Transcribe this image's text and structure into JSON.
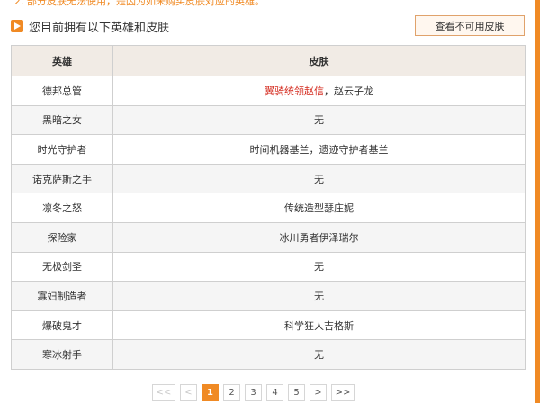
{
  "top_note": "2.   部分皮肤无法使用，是因为如未购买皮肤对应的英雄。",
  "header": {
    "title": "您目前拥有以下英雄和皮肤",
    "unavailable_button": "查看不可用皮肤"
  },
  "table": {
    "columns": [
      "英雄",
      "皮肤"
    ],
    "rows": [
      {
        "hero": "德邦总管",
        "skin_highlight": "翼骑统领赵信",
        "skin_rest": "，赵云子龙"
      },
      {
        "hero": "黑暗之女",
        "skin_highlight": "",
        "skin_rest": "无"
      },
      {
        "hero": "时光守护者",
        "skin_highlight": "",
        "skin_rest": "时间机器基兰，遗迹守护者基兰"
      },
      {
        "hero": "诺克萨斯之手",
        "skin_highlight": "",
        "skin_rest": "无"
      },
      {
        "hero": "凛冬之怒",
        "skin_highlight": "",
        "skin_rest": "传统造型瑟庄妮"
      },
      {
        "hero": "探险家",
        "skin_highlight": "",
        "skin_rest": "冰川勇者伊泽瑞尔"
      },
      {
        "hero": "无极剑圣",
        "skin_highlight": "",
        "skin_rest": "无"
      },
      {
        "hero": "寡妇制造者",
        "skin_highlight": "",
        "skin_rest": "无"
      },
      {
        "hero": "爆破鬼才",
        "skin_highlight": "",
        "skin_rest": "科学狂人吉格斯"
      },
      {
        "hero": "寒冰射手",
        "skin_highlight": "",
        "skin_rest": "无"
      }
    ]
  },
  "pagination": {
    "first": "<<",
    "prev": "<",
    "pages": [
      "1",
      "2",
      "3",
      "4",
      "5"
    ],
    "current": "1",
    "next": ">",
    "last": ">>"
  },
  "colors": {
    "accent": "#f08a24",
    "highlight_red": "#d42a1e",
    "header_bg": "#f1ebe5"
  },
  "icons": {
    "section": "play-icon"
  }
}
